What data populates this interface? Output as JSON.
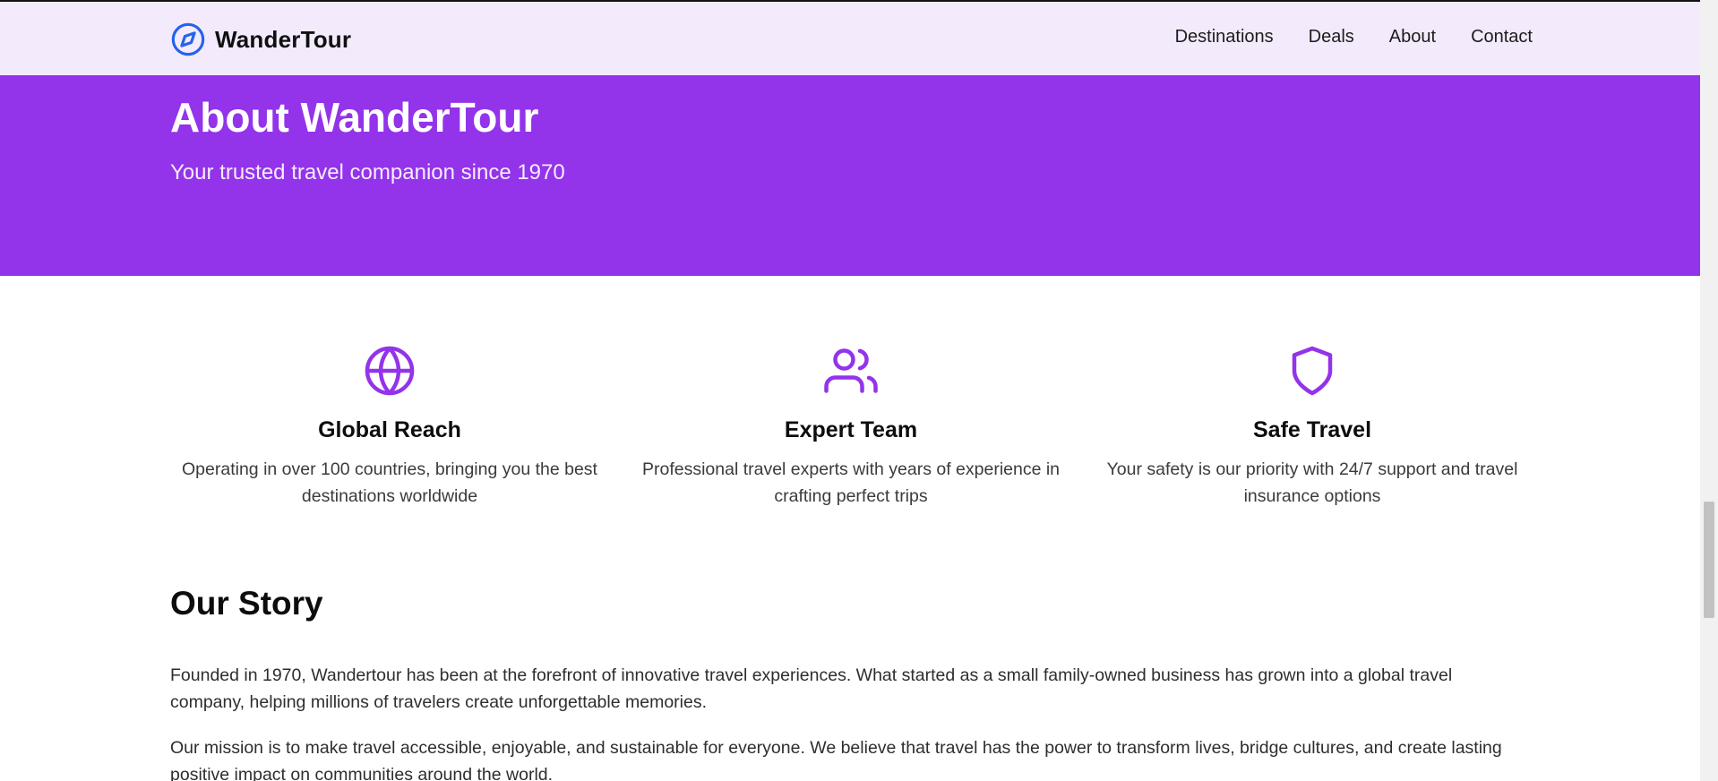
{
  "header": {
    "brand_name": "WanderTour",
    "brand_icon": "compass-icon",
    "nav": [
      "Destinations",
      "Deals",
      "About",
      "Contact"
    ]
  },
  "hero": {
    "title": "About WanderTour",
    "subtitle": "Your trusted travel companion since 1970"
  },
  "features": [
    {
      "icon": "globe-icon",
      "title": "Global Reach",
      "description": "Operating in over 100 countries, bringing you the best destinations worldwide"
    },
    {
      "icon": "users-icon",
      "title": "Expert Team",
      "description": "Professional travel experts with years of experience in crafting perfect trips"
    },
    {
      "icon": "shield-icon",
      "title": "Safe Travel",
      "description": "Your safety is our priority with 24/7 support and travel insurance options"
    }
  ],
  "story": {
    "heading": "Our Story",
    "paragraphs": [
      "Founded in 1970, Wandertour has been at the forefront of innovative travel experiences. What started as a small family-owned business has grown into a global travel company, helping millions of travelers create unforgettable memories.",
      "Our mission is to make travel accessible, enjoyable, and sustainable for everyone. We believe that travel has the power to transform lives, bridge cultures, and create lasting positive impact on communities around the world."
    ]
  },
  "colors": {
    "accent": "#9333ea",
    "header_bg": "#f3eafb",
    "brand_icon": "#2563eb"
  }
}
